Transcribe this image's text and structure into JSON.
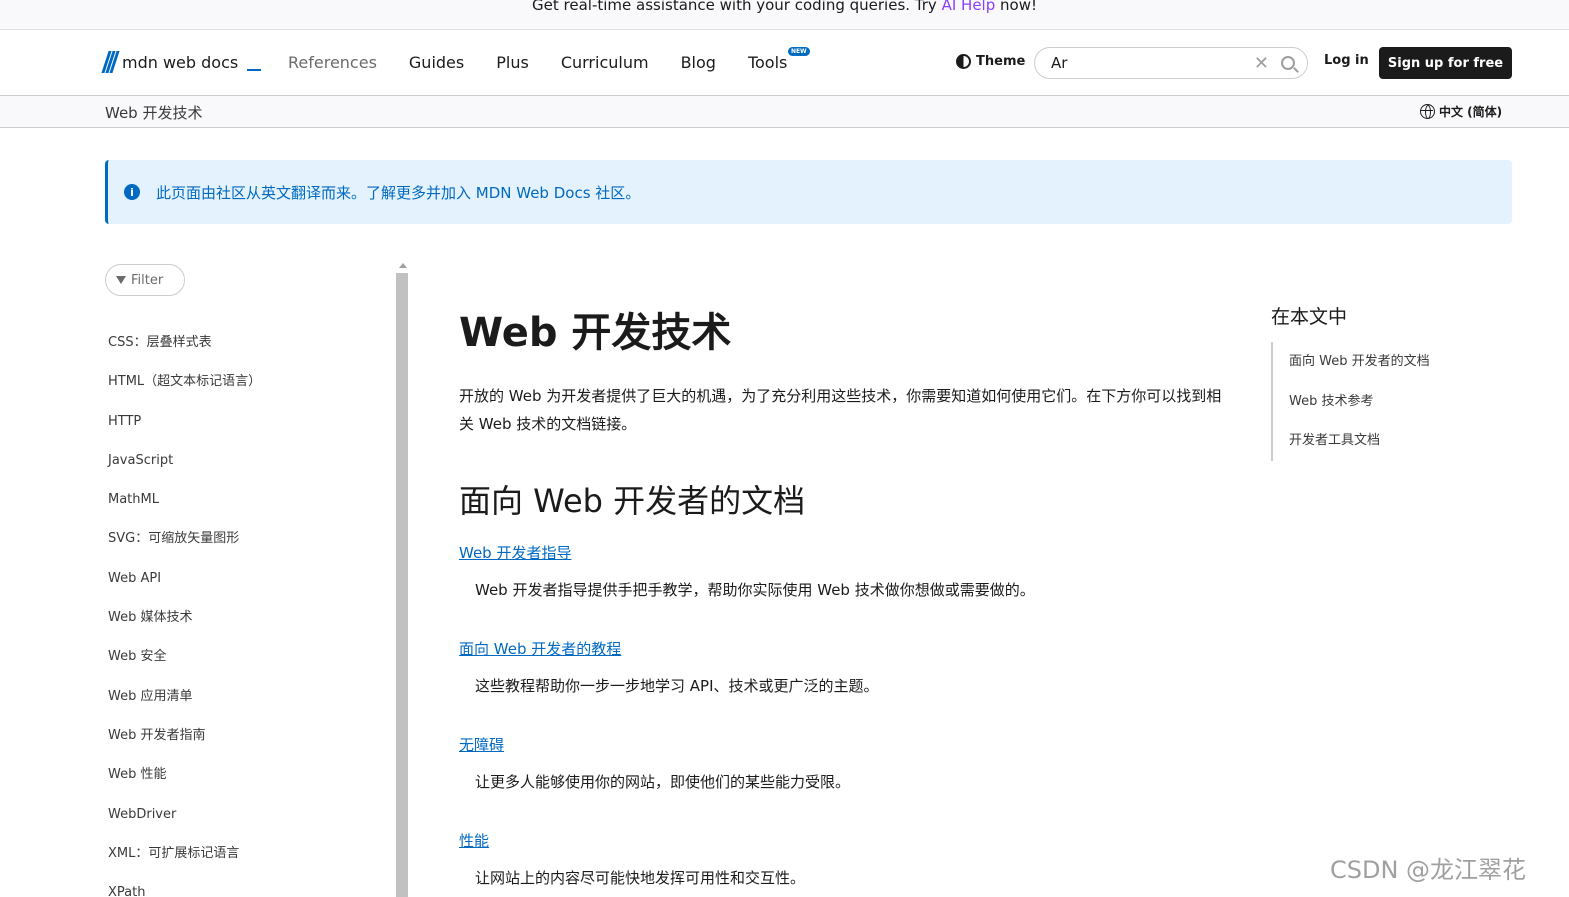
{
  "banner": {
    "prefix": "Get real-time assistance with your coding queries. Try ",
    "link": "AI Help",
    "suffix": " now!"
  },
  "header": {
    "logo_text": "mdn web docs",
    "nav": [
      "References",
      "Guides",
      "Plus",
      "Curriculum",
      "Blog",
      "Tools"
    ],
    "tools_badge": "NEW",
    "theme_label": "Theme",
    "search_value": "Ar",
    "login": "Log in",
    "signup": "Sign up for free"
  },
  "breadcrumb": {
    "current": "Web 开发技术",
    "language": "中文 (简体)"
  },
  "notice": {
    "icon": "info-icon",
    "text": "此页面由社区从英文翻译而来。了解更多并加入 MDN Web Docs 社区。"
  },
  "sidebar": {
    "filter": "Filter",
    "items": [
      "CSS：层叠样式表",
      "HTML（超文本标记语言）",
      "HTTP",
      "JavaScript",
      "MathML",
      "SVG：可缩放矢量图形",
      "Web API",
      "Web 媒体技术",
      "Web 安全",
      "Web 应用清单",
      "Web 开发者指南",
      "Web 性能",
      "WebDriver",
      "XML：可扩展标记语言",
      "XPath"
    ]
  },
  "main": {
    "title": "Web 开发技术",
    "intro": "开放的 Web 为开发者提供了巨大的机遇，为了充分利用这些技术，你需要知道如何使用它们。在下方你可以找到相关 Web 技术的文档链接。",
    "section_title": "面向 Web 开发者的文档",
    "entries": [
      {
        "link": "Web 开发者指导",
        "desc": "Web 开发者指导提供手把手教学，帮助你实际使用 Web 技术做你想做或需要做的。"
      },
      {
        "link": "面向 Web 开发者的教程",
        "desc": "这些教程帮助你一步一步地学习 API、技术或更广泛的主题。"
      },
      {
        "link": "无障碍",
        "desc": "让更多人能够使用你的网站，即使他们的某些能力受限。"
      },
      {
        "link": "性能",
        "desc": "让网站上的内容尽可能快地发挥可用性和交互性。"
      }
    ]
  },
  "toc": {
    "title": "在本文中",
    "items": [
      "面向 Web 开发者的文档",
      "Web 技术参考",
      "开发者工具文档"
    ]
  },
  "watermark": "CSDN @龙江翠花"
}
